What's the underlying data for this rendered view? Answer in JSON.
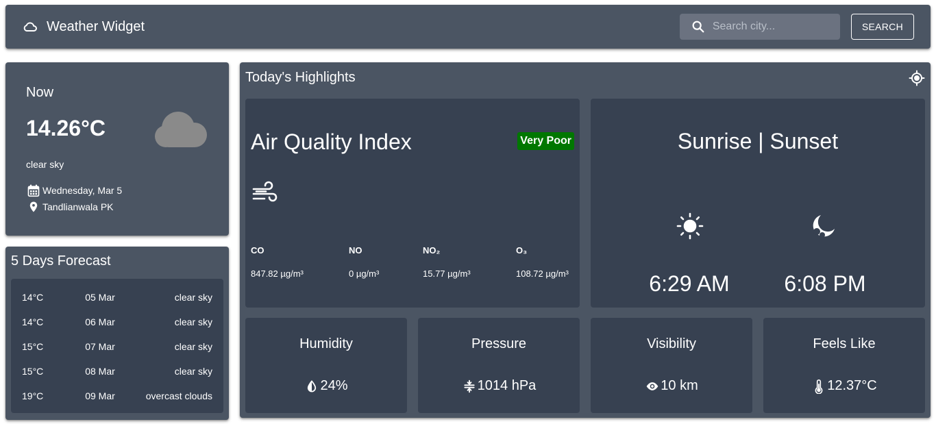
{
  "header": {
    "title": "Weather Widget",
    "search_placeholder": "Search city...",
    "search_button": "SEARCH",
    "logo_icon": "cloud-outline-icon"
  },
  "now": {
    "label": "Now",
    "temperature": "14.26°C",
    "description": "clear sky",
    "date": "Wednesday, Mar 5",
    "location": "Tandlianwala PK",
    "icon": "cloud-icon"
  },
  "forecast": {
    "title": "5 Days Forecast",
    "days": [
      {
        "temp": "14°C",
        "date": "05 Mar",
        "desc": "clear sky"
      },
      {
        "temp": "14°C",
        "date": "06 Mar",
        "desc": "clear sky"
      },
      {
        "temp": "15°C",
        "date": "07 Mar",
        "desc": "clear sky"
      },
      {
        "temp": "15°C",
        "date": "08 Mar",
        "desc": "clear sky"
      },
      {
        "temp": "19°C",
        "date": "09 Mar",
        "desc": "overcast clouds"
      }
    ]
  },
  "highlights": {
    "title": "Today's Highlights",
    "aqi": {
      "title": "Air Quality Index",
      "status": "Very Poor",
      "status_color": "#007700",
      "pollutants": [
        {
          "name": "CO",
          "value": "847.82 µg/m³"
        },
        {
          "name": "NO",
          "value": "0 µg/m³"
        },
        {
          "name": "NO₂",
          "value": "15.77 µg/m³"
        },
        {
          "name": "O₃",
          "value": "108.72 µg/m³"
        }
      ]
    },
    "sun": {
      "title": "Sunrise | Sunset",
      "sunrise": "6:29 AM",
      "sunset": "6:08 PM"
    },
    "humidity": {
      "label": "Humidity",
      "value": "24%"
    },
    "pressure": {
      "label": "Pressure",
      "value": "1014 hPa"
    },
    "visibility": {
      "label": "Visibility",
      "value": "10 km"
    },
    "feels_like": {
      "label": "Feels Like",
      "value": "12.37°C"
    }
  },
  "colors": {
    "card": "#4b5563",
    "inner_card": "#374151",
    "search_bg": "#6b7280"
  }
}
